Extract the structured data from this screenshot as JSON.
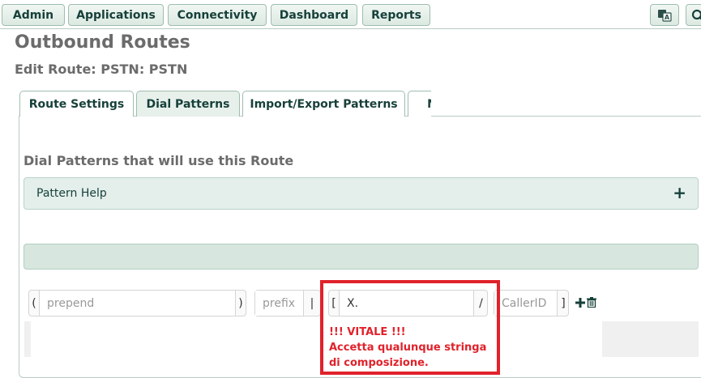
{
  "nav": {
    "items": [
      "Admin",
      "Applications",
      "Connectivity",
      "Dashboard",
      "Reports"
    ],
    "language_icon": "translate-icon",
    "search_icon": "search-icon"
  },
  "page": {
    "title": "Outbound Routes",
    "subtitle": "Edit Route: PSTN: PSTN"
  },
  "tabs": [
    {
      "label": "Route Settings",
      "active": false
    },
    {
      "label": "Dial Patterns",
      "active": true
    },
    {
      "label": "Import/Export Patterns",
      "active": false
    },
    {
      "label": "N",
      "active": false
    }
  ],
  "dial_patterns": {
    "section_title": "Dial Patterns that will use this Route",
    "help_label": "Pattern Help",
    "help_toggle": "+",
    "row": {
      "open_paren": "(",
      "prepend_placeholder": "prepend",
      "close_paren": ")",
      "prefix_placeholder": "prefix",
      "pipe": "|",
      "open_bracket": "[",
      "match_value": "X.",
      "slash": "/",
      "callerid_placeholder": "CallerID",
      "close_bracket": "]",
      "add_icon": "plus-icon",
      "delete_icon": "trash-icon"
    }
  },
  "annotation": {
    "line1": "!!! VITALE !!!",
    "line2": "Accetta qualunque stringa di composizione.",
    "color": "#e0222b"
  },
  "colors": {
    "brand": "#17403a",
    "tab_active_bg": "#e8f0ec",
    "help_bg": "#e4efec"
  }
}
